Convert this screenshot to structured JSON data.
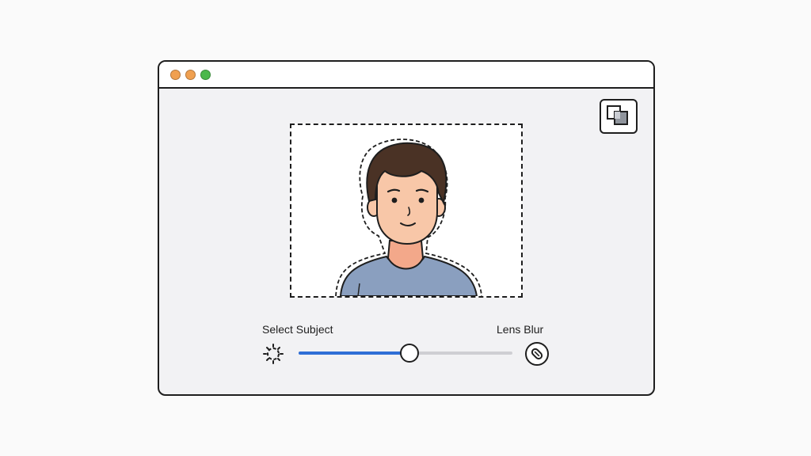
{
  "window": {
    "controls": [
      {
        "name": "close",
        "color": "#f0a050"
      },
      {
        "name": "minimize",
        "color": "#f0a050"
      },
      {
        "name": "zoom",
        "color": "#4cb84c"
      }
    ]
  },
  "toolbar": {
    "compare_icon": "compare-layers-icon"
  },
  "editor": {
    "left_label": "Select Subject",
    "right_label": "Lens Blur",
    "left_icon": "select-subject-icon",
    "right_icon": "lens-blur-icon",
    "slider_value": 0.52,
    "slider_fill_color": "#2f6fd6"
  },
  "colors": {
    "hair": "#4a3225",
    "skin": "#f8c7a8",
    "shirt": "#8a9fbf",
    "outline": "#1e1e1e"
  }
}
